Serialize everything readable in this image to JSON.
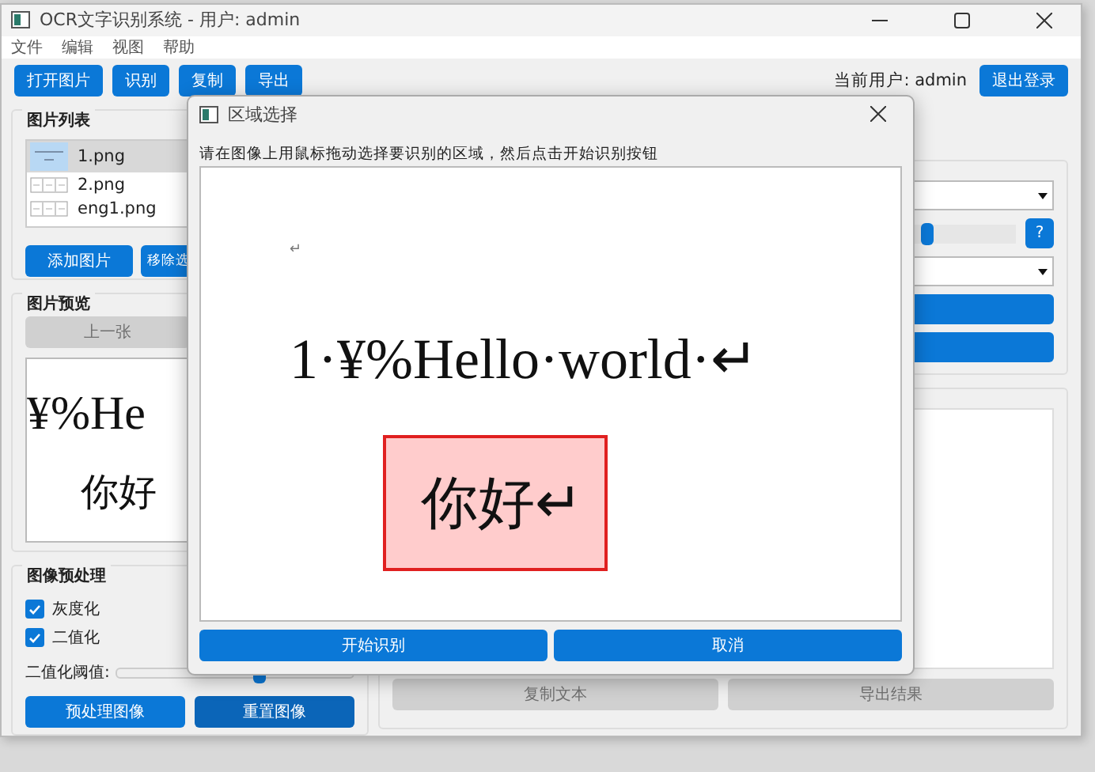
{
  "window": {
    "title": "OCR文字识别系统 - 用户: admin"
  },
  "menu": [
    "文件",
    "编辑",
    "视图",
    "帮助"
  ],
  "toolbar": {
    "buttons": [
      "打开图片",
      "识别",
      "复制",
      "导出"
    ],
    "user_label": "当前用户: admin",
    "logout": "退出登录"
  },
  "image_list": {
    "title": "图片列表",
    "items": [
      {
        "name": "1.png",
        "selected": true
      },
      {
        "name": "2.png",
        "selected": false
      },
      {
        "name": "eng1.png",
        "selected": false
      }
    ],
    "buttons": [
      "添加图片",
      "移除选"
    ]
  },
  "preview": {
    "title": "图片预览",
    "prev_button": {
      "label": "上一张",
      "disabled": true
    },
    "image_lines": [
      "¥%He",
      "你好"
    ]
  },
  "preprocess": {
    "title": "图像预处理",
    "options": [
      {
        "label": "灰度化",
        "checked": true
      },
      {
        "label": "二值化",
        "checked": true
      }
    ],
    "threshold_label": "二值化阈值:",
    "threshold_slider": {
      "level": 0.6
    },
    "buttons": [
      "预处理图像",
      "重置图像"
    ]
  },
  "settings": {
    "help_button": "?",
    "slider": {
      "level": 0.4
    }
  },
  "results": {
    "buttons": [
      {
        "label": "复制文本",
        "disabled": true
      },
      {
        "label": "导出结果",
        "disabled": true
      }
    ]
  },
  "dialog": {
    "title": "区域选择",
    "instruction": "请在图像上用鼠标拖动选择要识别的区域，然后点击开始识别按钮",
    "canvas_lines": [
      "↵",
      "1·¥%Hello·world·↵"
    ],
    "selection_text": "你好↵",
    "buttons": [
      "开始识别",
      "取消"
    ]
  }
}
